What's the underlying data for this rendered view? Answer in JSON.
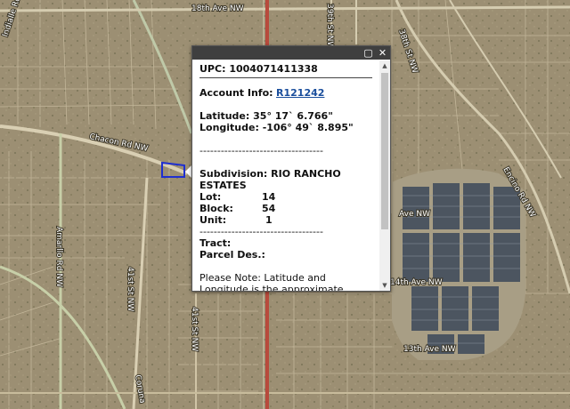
{
  "map": {
    "roads": {
      "top": "18th Ave NW",
      "left_diag": "Indialle Rd NW",
      "chacon": "Chacon Rd NW",
      "west_vert": "Amarllo Rd NW",
      "st41_low": "41st St NW",
      "st41_mid": "41st St NW",
      "st39": "39th St NW",
      "st38": "38th St NW",
      "encino": "Encino Rd NW",
      "ave_right": "Ave NW",
      "ave14": "14th Ave NW",
      "ave13": "13th Ave NW",
      "bottom_left": "Coruna"
    },
    "colors": {
      "terrain": "#9c8f73",
      "highway": "#b84a3c",
      "parcel_outline": "#1f2fd0"
    }
  },
  "popup": {
    "upc_label": "UPC:",
    "upc_value": "1004071411338",
    "account_label": "Account Info:",
    "account_link": "R121242",
    "lat_label": "Latitude:",
    "lat_value": "35° 17` 6.766\"",
    "lon_label": "Longitude:",
    "lon_value": "-106° 49` 8.895\"",
    "divider": "-----------------------------------",
    "subdivision_label": "Subdivision:",
    "subdivision_value": "RIO RANCHO ESTATES",
    "lot_label": "Lot:",
    "lot_value": "14",
    "block_label": "Block:",
    "block_value": "54",
    "unit_label": "Unit:",
    "unit_value": "1",
    "tract_label": "Tract:",
    "parcel_label": "Parcel Des.:",
    "note": "Please Note: Latitude and Longitude is the approximate center of the parcel shown."
  },
  "icons": {
    "maximize": "maximize-icon",
    "close": "close-icon"
  }
}
